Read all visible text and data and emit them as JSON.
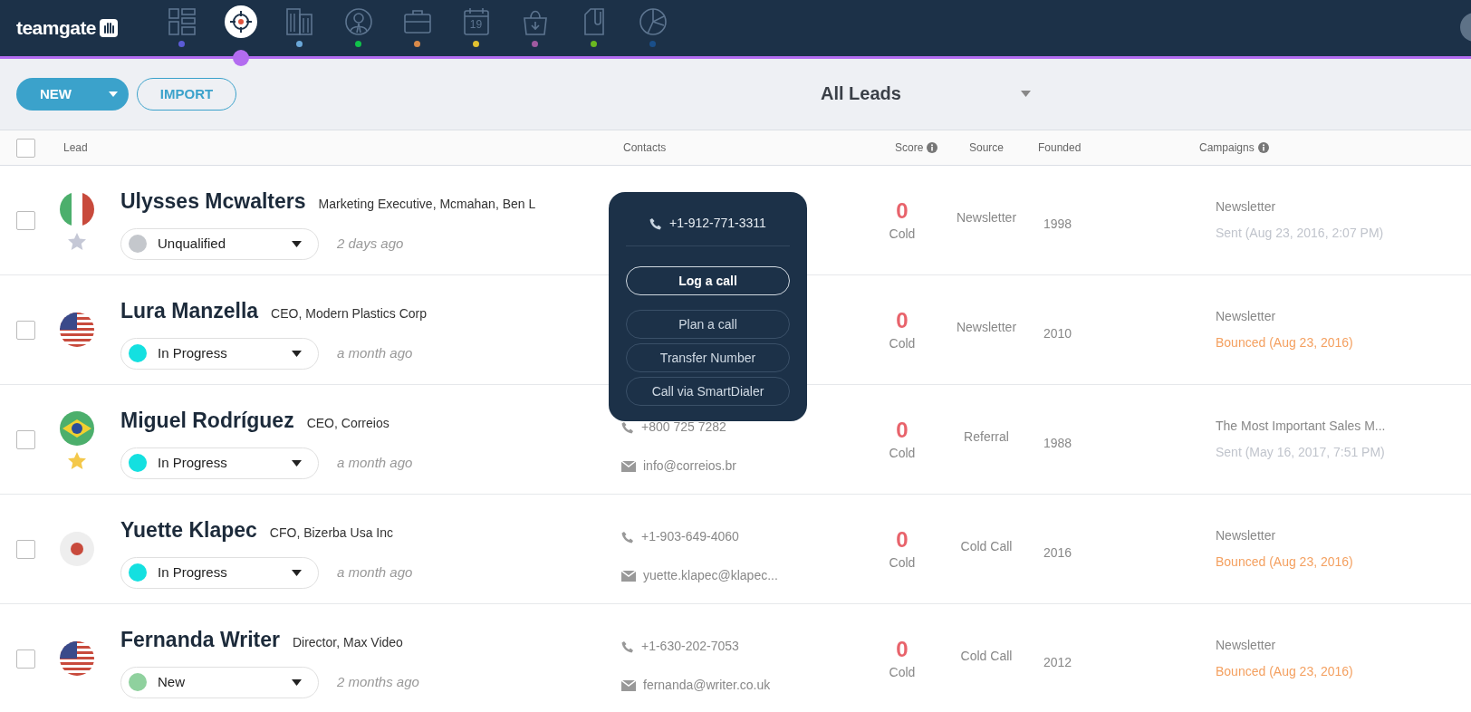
{
  "app": {
    "logo": "teamgate"
  },
  "nav": [
    {
      "color": "#5b5bd6",
      "selected": false
    },
    {
      "color": "#b36cf0",
      "selected": true
    },
    {
      "color": "#6aa7d8",
      "selected": false
    },
    {
      "color": "#10c24a",
      "selected": false
    },
    {
      "color": "#d98a4a",
      "selected": false
    },
    {
      "day": "19",
      "color": "#e0c030",
      "selected": false
    },
    {
      "color": "#a05aa0",
      "selected": false
    },
    {
      "color": "#6ab820",
      "selected": false
    },
    {
      "color": "#1a4f8a",
      "selected": false
    }
  ],
  "toolbar": {
    "new_button": "NEW",
    "import_button": "IMPORT",
    "view": "All Leads"
  },
  "table": {
    "select_all": {
      "checked": false
    },
    "columns": [
      {
        "label": "Lead"
      },
      {
        "label": "Contacts"
      },
      {
        "label": "Score"
      },
      {
        "label": "Source"
      },
      {
        "label": "Founded"
      },
      {
        "label": "Campaigns"
      }
    ],
    "rows": [
      {
        "checked": false,
        "starred": false,
        "name": "Ulysses Mcwalters",
        "title": "Marketing Executive, Mcmahan, Ben L",
        "status": "Unqualified",
        "color": "#c4c7cc",
        "age": "2 days ago",
        "score": "0",
        "score_label": "Cold",
        "source": "Newsletter",
        "founded": "1998",
        "campaign": "Newsletter",
        "campaign_status": "Sent (Aug 23, 2016, 2:07 PM)",
        "bounced": false
      },
      {
        "checked": false,
        "name": "Lura Manzella",
        "title": "CEO, Modern Plastics Corp",
        "status": "In Progress",
        "color": "#14e0e0",
        "age": "a month ago",
        "score": "0",
        "score_label": "Cold",
        "source": "Newsletter",
        "founded": "2010",
        "campaign": "Newsletter",
        "campaign_status": "Bounced (Aug 23, 2016)",
        "bounced": true
      },
      {
        "checked": false,
        "starred": true,
        "name": "Miguel Rodríguez",
        "title": "CEO, Correios",
        "status": "In Progress",
        "color": "#14e0e0",
        "age": "a month ago",
        "phone": "+800 725 7282",
        "email": "info@correios.br",
        "score": "0",
        "score_label": "Cold",
        "source": "Referral",
        "founded": "1988",
        "campaign": "The Most Important Sales M...",
        "campaign_status": "Sent (May 16, 2017, 7:51 PM)",
        "bounced": false
      },
      {
        "checked": false,
        "name": "Yuette Klapec",
        "title": "CFO, Bizerba Usa Inc",
        "status": "In Progress",
        "color": "#14e0e0",
        "age": "a month ago",
        "phone": "+1-903-649-4060",
        "email": "yuette.klapec@klapec...",
        "score": "0",
        "score_label": "Cold",
        "source": "Cold Call",
        "founded": "2016",
        "campaign": "Newsletter",
        "campaign_status": "Bounced (Aug 23, 2016)",
        "bounced": true
      },
      {
        "checked": false,
        "name": "Fernanda Writer",
        "title": "Director, Max Video",
        "status": "New",
        "color": "#8fd19e",
        "age": "2 months ago",
        "phone": "+1-630-202-7053",
        "email": "fernanda@writer.co.uk",
        "score": "0",
        "score_label": "Cold",
        "source": "Cold Call",
        "founded": "2012",
        "campaign": "Newsletter",
        "campaign_status": "Bounced (Aug 23, 2016)",
        "bounced": true
      }
    ]
  },
  "call_popover": {
    "phone": "+1-912-771-3311",
    "actions": [
      {
        "label": "Log a call",
        "primary": true
      },
      {
        "label": "Plan a call",
        "primary": false
      },
      {
        "label": "Transfer Number",
        "primary": false
      },
      {
        "label": "Call via SmartDialer",
        "primary": false
      }
    ]
  }
}
